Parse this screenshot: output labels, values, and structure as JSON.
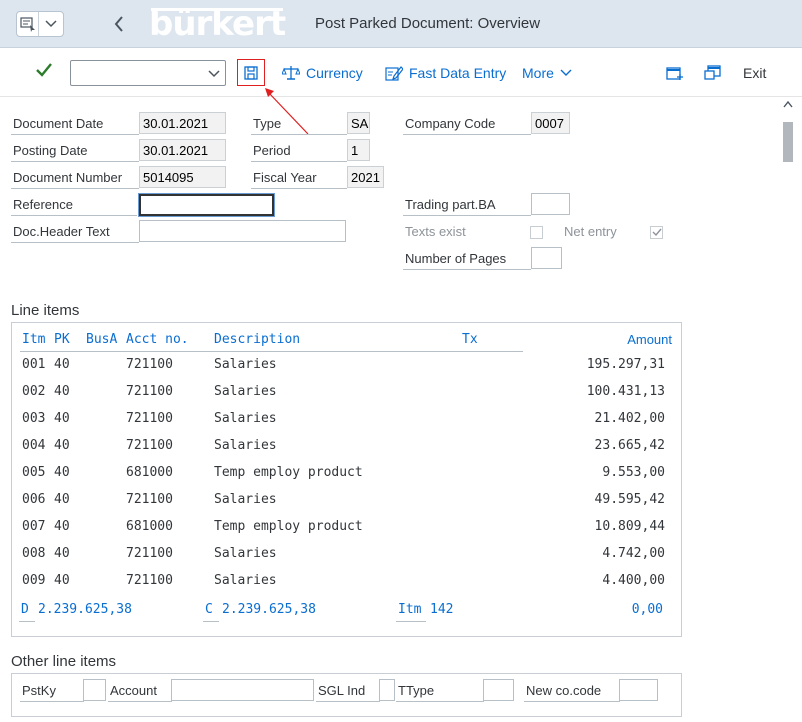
{
  "titlebar": {
    "logo": "bürkert",
    "title": "Post Parked Document: Overview"
  },
  "toolbar": {
    "variant_value": "",
    "currency_label": "Currency",
    "fast_data_entry_label": "Fast Data Entry",
    "more_label": "More",
    "exit_label": "Exit"
  },
  "header": {
    "document_date_label": "Document Date",
    "document_date": "30.01.2021",
    "posting_date_label": "Posting Date",
    "posting_date": "30.01.2021",
    "document_number_label": "Document Number",
    "document_number": "5014095",
    "reference_label": "Reference",
    "reference": "",
    "doc_header_text_label": "Doc.Header Text",
    "doc_header_text": "",
    "type_label": "Type",
    "type": "SA",
    "period_label": "Period",
    "period": "1",
    "fiscal_year_label": "Fiscal Year",
    "fiscal_year": "2021",
    "company_code_label": "Company Code",
    "company_code": "0007",
    "trading_part_label": "Trading part.BA",
    "texts_exist_label": "Texts exist",
    "net_entry_label": "Net entry",
    "number_of_pages_label": "Number of Pages"
  },
  "line_items": {
    "title": "Line items",
    "columns": {
      "itm": "Itm",
      "pk": "PK",
      "busa": "BusA",
      "acct": "Acct no.",
      "desc": "Description",
      "tx": "Tx",
      "amount": "Amount"
    },
    "rows": [
      {
        "itm": "001",
        "pk": "40",
        "busa": "",
        "acct": "721100",
        "desc": "Salaries",
        "tx": "",
        "amount": "195.297,31"
      },
      {
        "itm": "002",
        "pk": "40",
        "busa": "",
        "acct": "721100",
        "desc": "Salaries",
        "tx": "",
        "amount": "100.431,13"
      },
      {
        "itm": "003",
        "pk": "40",
        "busa": "",
        "acct": "721100",
        "desc": "Salaries",
        "tx": "",
        "amount": "21.402,00"
      },
      {
        "itm": "004",
        "pk": "40",
        "busa": "",
        "acct": "721100",
        "desc": "Salaries",
        "tx": "",
        "amount": "23.665,42"
      },
      {
        "itm": "005",
        "pk": "40",
        "busa": "",
        "acct": "681000",
        "desc": "Temp employ product",
        "tx": "",
        "amount": "9.553,00"
      },
      {
        "itm": "006",
        "pk": "40",
        "busa": "",
        "acct": "721100",
        "desc": "Salaries",
        "tx": "",
        "amount": "49.595,42"
      },
      {
        "itm": "007",
        "pk": "40",
        "busa": "",
        "acct": "681000",
        "desc": "Temp employ product",
        "tx": "",
        "amount": "10.809,44"
      },
      {
        "itm": "008",
        "pk": "40",
        "busa": "",
        "acct": "721100",
        "desc": "Salaries",
        "tx": "",
        "amount": "4.742,00"
      },
      {
        "itm": "009",
        "pk": "40",
        "busa": "",
        "acct": "721100",
        "desc": "Salaries",
        "tx": "",
        "amount": "4.400,00"
      }
    ],
    "totals": {
      "d_label": "D",
      "d_value": "2.239.625,38",
      "c_label": "C",
      "c_value": "2.239.625,38",
      "itm_label": "Itm",
      "itm_value": "142",
      "balance": "0,00"
    }
  },
  "other_line_items": {
    "title": "Other line items",
    "pstky_label": "PstKy",
    "account_label": "Account",
    "sgl_ind_label": "SGL Ind",
    "ttype_label": "TType",
    "new_co_code_label": "New co.code"
  },
  "colors": {
    "titlebar_bg": "#dde6ef",
    "accent_blue": "#0a6ed1",
    "highlight_red": "#e02020",
    "check_green": "#2b7c2b"
  },
  "icons": [
    "menu-icon",
    "chevron-down-icon",
    "back-icon",
    "check-icon",
    "save-icon",
    "scales-icon",
    "edit-list-icon",
    "new-window-icon",
    "restore-window-icon",
    "scroll-up-icon"
  ]
}
